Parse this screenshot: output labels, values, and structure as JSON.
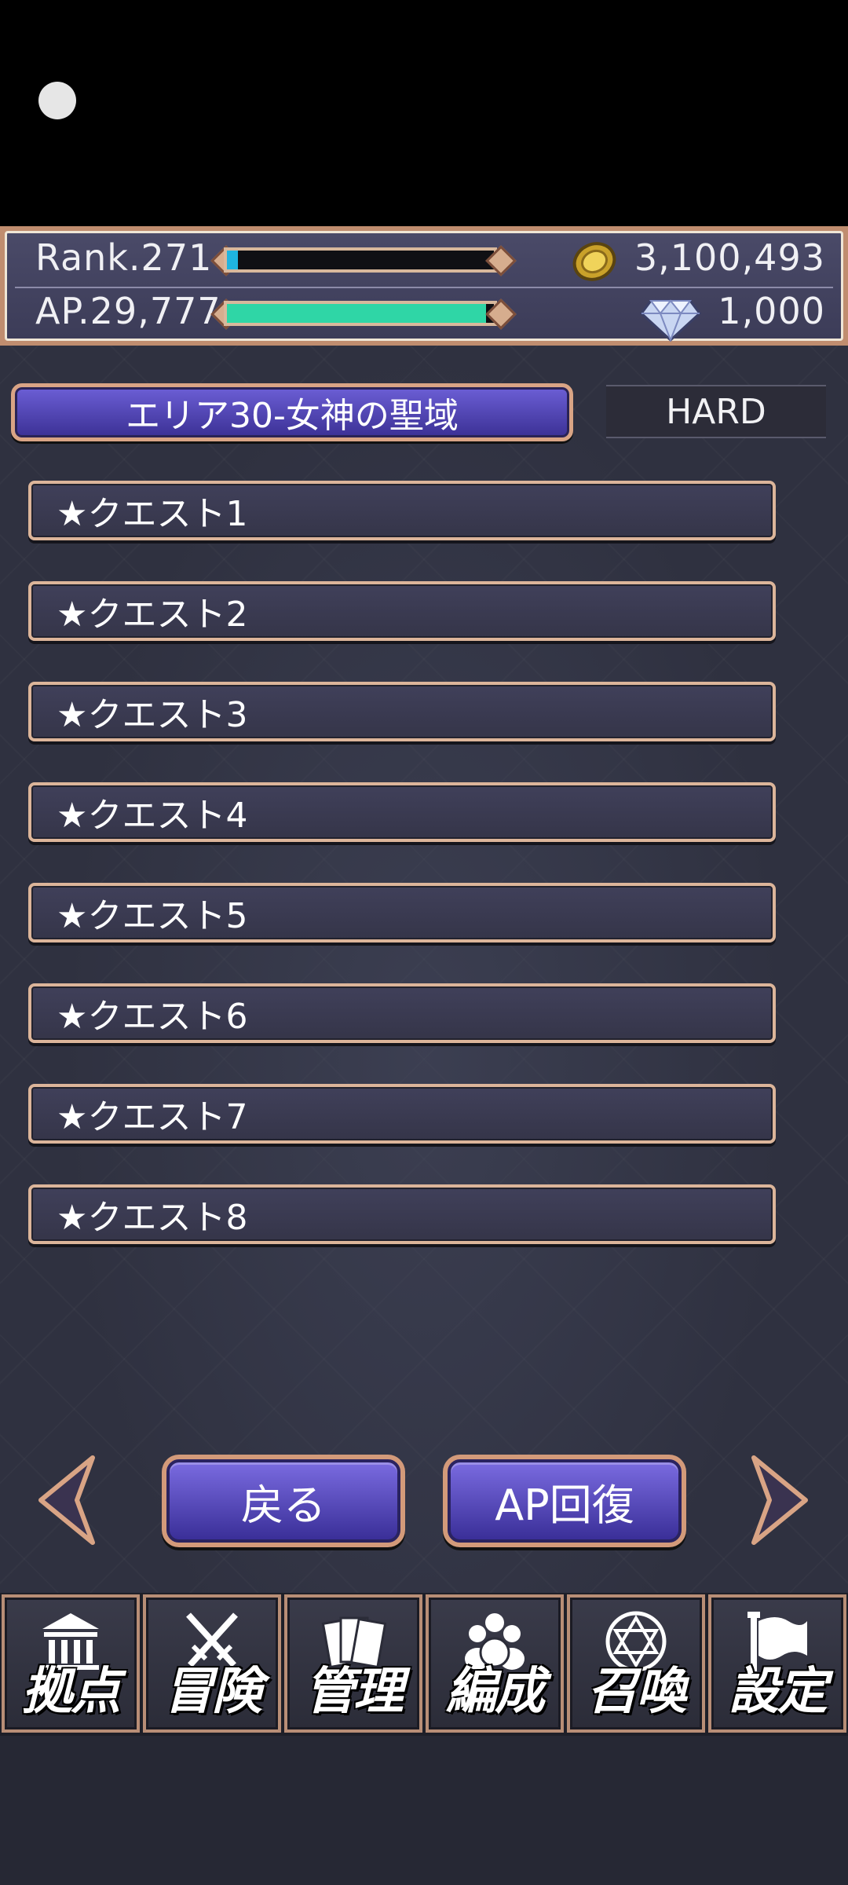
{
  "hud": {
    "rank_label": "Rank.271",
    "rank_progress": 0.04,
    "ap_label": "AP.29,777",
    "ap_progress": 0.97,
    "gold": "3,100,493",
    "gems": "1,000",
    "gold_icon": "gold-coin-icon",
    "gem_icon": "diamond-icon"
  },
  "area": {
    "title": "エリア30-女神の聖域",
    "difficulty": "HARD"
  },
  "quests": [
    "★クエスト1",
    "★クエスト2",
    "★クエスト3",
    "★クエスト4",
    "★クエスト5",
    "★クエスト6",
    "★クエスト7",
    "★クエスト8"
  ],
  "controls": {
    "back_label": "戻る",
    "ap_recover_label": "AP回復"
  },
  "nav": [
    {
      "label": "拠点",
      "icon": "building-icon"
    },
    {
      "label": "冒険",
      "icon": "swords-icon"
    },
    {
      "label": "管理",
      "icon": "cards-icon"
    },
    {
      "label": "編成",
      "icon": "party-icon"
    },
    {
      "label": "召喚",
      "icon": "hexagram-icon"
    },
    {
      "label": "設定",
      "icon": "flag-icon"
    }
  ],
  "colors": {
    "accent": "#5b4fc8",
    "frame": "#d9a485",
    "rank_bar": "#1fb4e0",
    "ap_bar": "#2fd6a6"
  }
}
